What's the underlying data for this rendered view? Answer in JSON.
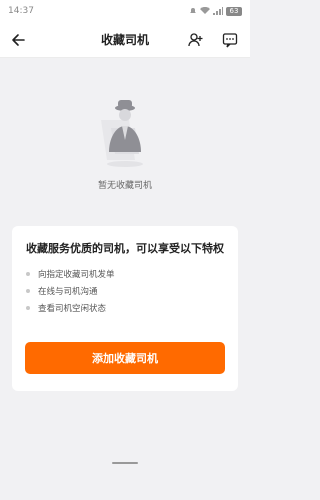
{
  "status_bar": {
    "time": "14:37",
    "battery": "63"
  },
  "nav": {
    "title": "收藏司机",
    "icons": [
      "back-arrow-icon",
      "add-user-icon",
      "message-icon"
    ]
  },
  "empty_state": {
    "text": "暂无收藏司机",
    "icon": "driver-placeholder-icon"
  },
  "card": {
    "title": "收藏服务优质的司机，可以享受以下特权",
    "benefits": [
      "向指定收藏司机发单",
      "在线与司机沟通",
      "查看司机空闲状态"
    ],
    "button_label": "添加收藏司机",
    "accent": "#ff6a00"
  }
}
